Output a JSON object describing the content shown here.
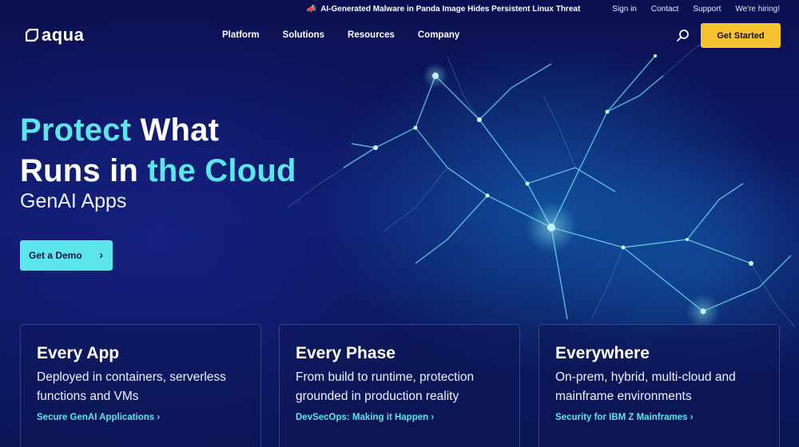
{
  "topbar": {
    "news_icon": "megaphone-icon",
    "news_text": "AI-Generated Malware in Panda Image Hides Persistent Linux Threat",
    "links": [
      "Sign in",
      "Contact",
      "Support",
      "We're hiring!"
    ]
  },
  "nav": {
    "logo_text": "aqua",
    "menu": [
      "Platform",
      "Solutions",
      "Resources",
      "Company"
    ],
    "search_icon": "search-icon",
    "cta_label": "Get Started"
  },
  "hero": {
    "title_part1_accent": "Protect",
    "title_part2": " What",
    "title_part3": "Runs in ",
    "title_part4_accent": "the Cloud",
    "subtitle": "GenAI Apps",
    "demo_label": "Get a Demo",
    "demo_chevron": "›"
  },
  "cards": [
    {
      "title": "Every App",
      "text": "Deployed in containers, serverless functions and VMs",
      "link": "Secure GenAI Applications ›"
    },
    {
      "title": "Every Phase",
      "text": "From build to runtime, protection grounded in production reality",
      "link": "DevSecOps: Making it Happen ›"
    },
    {
      "title": "Everywhere",
      "text": "On-prem, hybrid, multi-cloud and mainframe environments",
      "link": "Security for IBM Z Mainframes ›"
    }
  ],
  "colors": {
    "accent": "#5ce5ea",
    "cta": "#f6c431",
    "background": "#0b1050"
  }
}
